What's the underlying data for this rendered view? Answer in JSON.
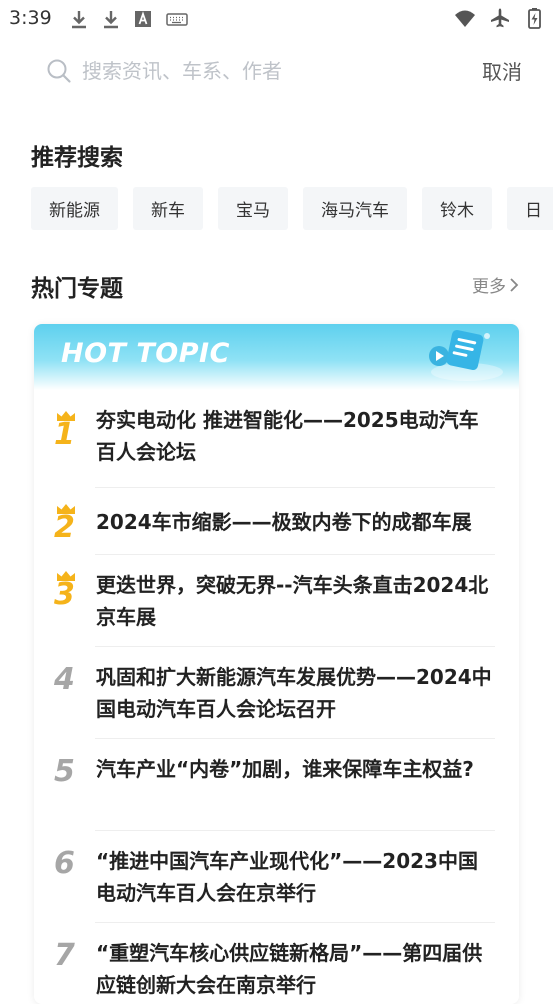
{
  "status_bar": {
    "time": "3:39",
    "left_icons": [
      "download-icon",
      "download-icon",
      "font-a-icon",
      "keyboard-icon"
    ],
    "right_icons": [
      "wifi-icon",
      "airplane-icon",
      "battery-charging-icon"
    ]
  },
  "search": {
    "placeholder": "搜索资讯、车系、作者",
    "value": "",
    "cancel_label": "取消"
  },
  "recommended": {
    "title": "推荐搜索",
    "tags": [
      "新能源",
      "新车",
      "宝马",
      "海马汽车",
      "铃木",
      "日"
    ]
  },
  "hot_topics": {
    "title": "热门专题",
    "more_label": "更多",
    "card_label": "HOT TOPIC",
    "items": [
      {
        "rank": "1",
        "text": "夯实电动化 推进智能化——2025电动汽车百人会论坛"
      },
      {
        "rank": "2",
        "text": "2024车市缩影——极致内卷下的成都车展"
      },
      {
        "rank": "3",
        "text": "更迭世界，突破无界--汽车头条直击2024北京车展"
      },
      {
        "rank": "4",
        "text": "巩固和扩大新能源汽车发展优势——2024中国电动汽车百人会论坛召开"
      },
      {
        "rank": "5",
        "text": "汽车产业“内卷”加剧，谁来保障车主权益?"
      },
      {
        "rank": "6",
        "text": "“推进中国汽车产业现代化”——2023中国电动汽车百人会在京举行"
      },
      {
        "rank": "7",
        "text": "“重塑汽车核心供应链新格局”——第四届供应链创新大会在南京举行"
      }
    ]
  },
  "colors": {
    "gold_rank": "#f5b31a",
    "grey_rank": "#a6a6a6",
    "header_cyan": "#5ed0ee",
    "tag_bg": "#f4f6f8"
  }
}
